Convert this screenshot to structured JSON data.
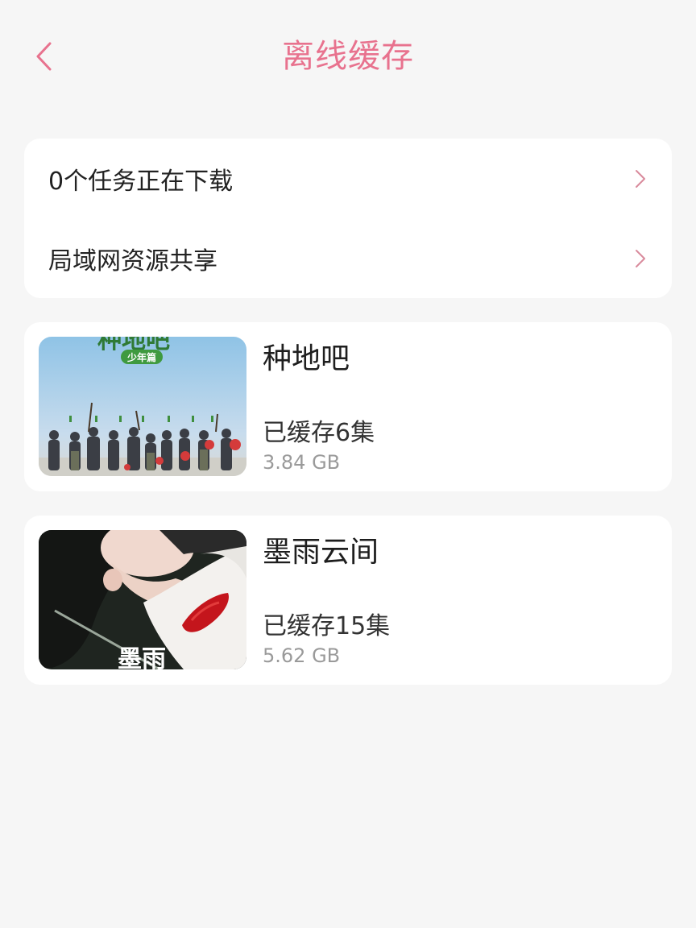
{
  "header": {
    "title": "离线缓存",
    "back_icon": "chevron-left-icon",
    "accent_color": "#e8728e"
  },
  "menu": {
    "items": [
      {
        "label": "0个任务正在下载",
        "icon": "chevron-right-icon"
      },
      {
        "label": "局域网资源共享",
        "icon": "chevron-right-icon"
      }
    ]
  },
  "videos": [
    {
      "title": "种地吧",
      "cached": "已缓存6集",
      "size": "3.84 GB",
      "poster_text": "少年篇"
    },
    {
      "title": "墨雨云间",
      "cached": "已缓存15集",
      "size": "5.62 GB",
      "poster_text": "墨雨"
    }
  ]
}
